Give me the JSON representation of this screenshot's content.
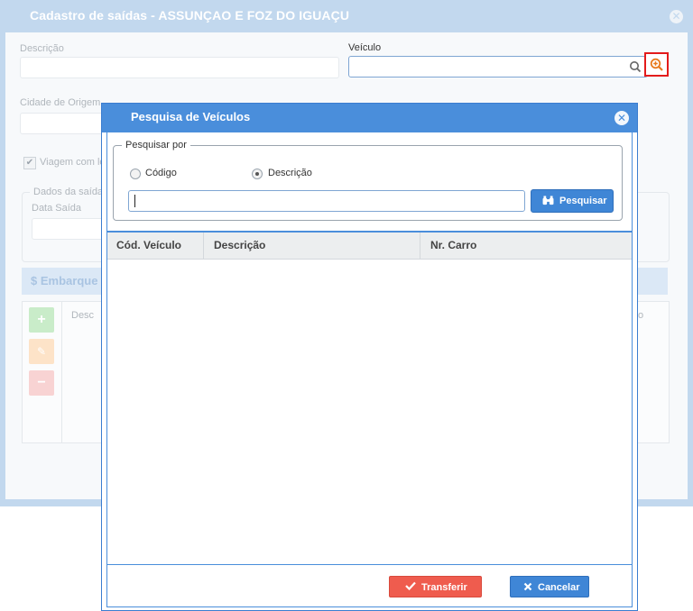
{
  "background_window": {
    "title": "Cadastro de saídas - ASSUNÇAO E FOZ DO IGUAÇU",
    "descricao_label": "Descrição",
    "veiculo_label": "Veículo",
    "cidade_origem_label": "Cidade de Origem",
    "viagem_checkbox_label": "Viagem com lo",
    "dados_saida_legend": "Dados da saída",
    "data_saida_label": "Data Saída",
    "embarque_tab_label": "Embarque",
    "embarque_col_descricao": "Desc",
    "embarque_col_right": "o"
  },
  "modal": {
    "title": "Pesquisa de Veículos",
    "search_group_legend": "Pesquisar por",
    "radio_options": [
      {
        "label": "Código",
        "selected": false
      },
      {
        "label": "Descrição",
        "selected": true
      }
    ],
    "search_input_value": "",
    "search_button_label": "Pesquisar",
    "table_columns": [
      "Cód. Veículo",
      "Descrição",
      "Nr. Carro"
    ],
    "table_rows": [],
    "transfer_button_label": "Transferir",
    "cancel_button_label": "Cancelar"
  },
  "colors": {
    "modal_header": "#4a8edb",
    "transfer_button": "#ef5c4e",
    "primary_button": "#3f86d6",
    "highlight_border": "#e31b1b"
  }
}
